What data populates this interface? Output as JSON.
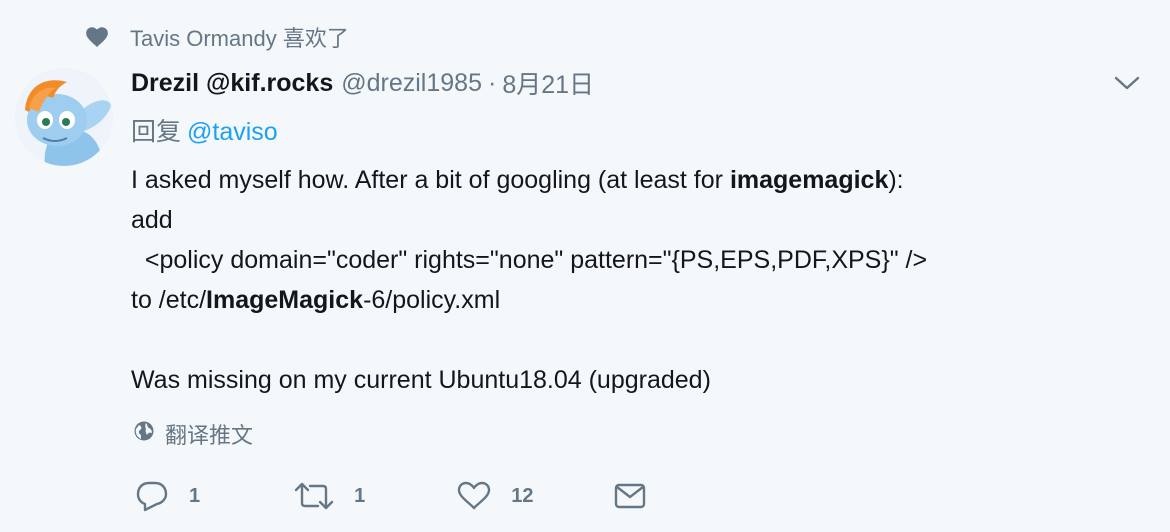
{
  "social_context": {
    "icon": "heart-icon",
    "text": "Tavis Ormandy 喜欢了"
  },
  "author": {
    "full_name": "Drezil @kif.rocks",
    "username": "@drezil1985",
    "separator": "·",
    "timestamp": "8月21日"
  },
  "reply": {
    "prefix": "回复",
    "mention": "@taviso"
  },
  "tweet": {
    "line1_pre": "I asked myself how. After a bit of googling (at least for ",
    "line1_bold": "imagemagick",
    "line1_post": "):",
    "line2": "add",
    "line3": "  <policy domain=\"coder\" rights=\"none\" pattern=\"{PS,EPS,PDF,XPS}\" />",
    "line4_pre": "to /etc/",
    "line4_bold": "ImageMagick",
    "line4_post": "-6/policy.xml",
    "line5": "",
    "line6": "Was missing on my current Ubuntu18.04 (upgraded)"
  },
  "translate_label": "翻译推文",
  "actions": {
    "reply_count": "1",
    "retweet_count": "1",
    "like_count": "12"
  },
  "colors": {
    "background": "#f5f8fa",
    "secondary_text": "#657786",
    "link": "#1da1f2",
    "primary_text": "#14171a"
  }
}
